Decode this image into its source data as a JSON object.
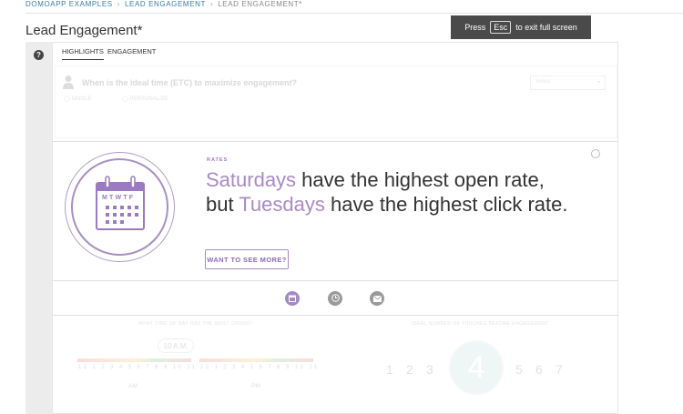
{
  "breadcrumb": {
    "items": [
      "DOMOAPP EXAMPLES",
      "LEAD ENGAGEMENT",
      "LEAD ENGAGEMENT*"
    ],
    "separator": "›"
  },
  "page": {
    "title": "Lead Engagement*"
  },
  "fullscreen_banner": {
    "pre": "Press",
    "key": "Esc",
    "post": "to exit full screen"
  },
  "help": {
    "glyph": "?"
  },
  "tabs": [
    {
      "label": "HIGHLIGHTS",
      "active": true
    },
    {
      "label": "ENGAGEMENT",
      "active": false
    }
  ],
  "question": {
    "text": "When is the ideal time (ETC) to maximize engagement?",
    "options": [
      "SINGLE",
      "PERSONALIZE"
    ],
    "dropdown_value": "Select"
  },
  "insight": {
    "category": "RATES",
    "headline_parts": [
      {
        "text": "Saturdays",
        "highlight": true
      },
      {
        "text": " have the highest open rate, but ",
        "highlight": false
      },
      {
        "text": "Tuesdays",
        "highlight": true
      },
      {
        "text": " have the highest click rate.",
        "highlight": false
      }
    ],
    "cta_label": "WANT TO SEE MORE?",
    "calendar_days": "MTWTF"
  },
  "carousel": {
    "icons": [
      "calendar-icon",
      "clock-icon",
      "mail-icon"
    ],
    "active_index": 0
  },
  "bottom": {
    "left_title": "WHAT TIME OF DAY HAS THE MOST OPENS?",
    "time_value": "10 A.M.",
    "hours": "12 1 2 3 4 5 6 7 8 9 10 11",
    "am": "AM",
    "pm": "PM",
    "right_title": "IDEAL NUMBER OF TOUCHES BEFORE ENGAGEMENT",
    "touches": [
      "1",
      "2",
      "3",
      "4",
      "5",
      "6",
      "7"
    ],
    "highlighted_touch": "4"
  },
  "colors": {
    "accent": "#a98ac6",
    "link": "#3a7ca5",
    "banner": "#4a4a4a"
  }
}
